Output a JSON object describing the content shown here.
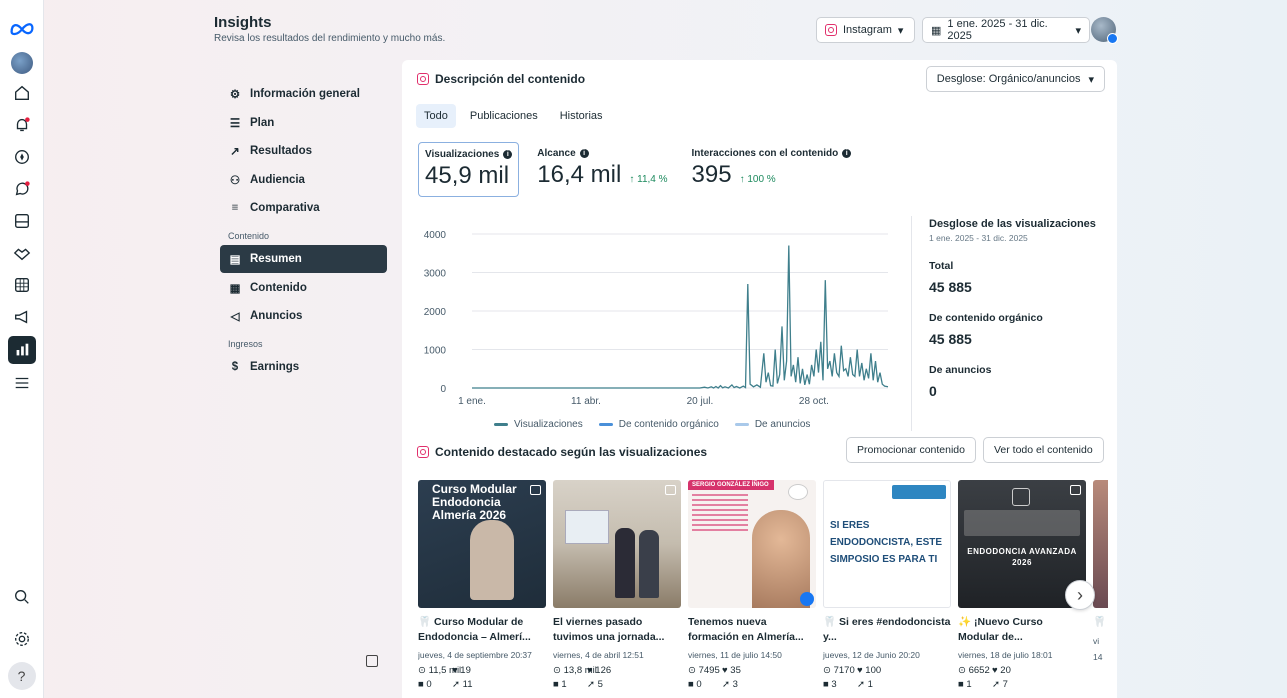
{
  "header": {
    "title": "Insights",
    "subtitle": "Revisa los resultados del rendimiento y mucho más.",
    "platform": "Instagram",
    "date_range": "1 ene. 2025 - 31 dic. 2025"
  },
  "nav": {
    "items": [
      {
        "label": "Información general",
        "icon": "network-icon"
      },
      {
        "label": "Plan",
        "icon": "list-icon"
      },
      {
        "label": "Resultados",
        "icon": "trend-icon"
      },
      {
        "label": "Audiencia",
        "icon": "people-icon"
      },
      {
        "label": "Comparativa",
        "icon": "compare-icon"
      }
    ],
    "section_content": "Contenido",
    "content_items": [
      {
        "label": "Resumen",
        "icon": "summary-icon",
        "active": true
      },
      {
        "label": "Contenido",
        "icon": "grid-icon"
      },
      {
        "label": "Anuncios",
        "icon": "megaphone-icon"
      }
    ],
    "section_income": "Ingresos",
    "income_items": [
      {
        "label": "Earnings",
        "icon": "dollar-icon"
      }
    ]
  },
  "content_overview": {
    "title": "Descripción del contenido",
    "breakdown_button": "Desglose: Orgánico/anuncios",
    "tabs": [
      "Todo",
      "Publicaciones",
      "Historias"
    ],
    "metrics": [
      {
        "label": "Visualizaciones",
        "value": "45,9 mil",
        "delta": ""
      },
      {
        "label": "Alcance",
        "value": "16,4 mil",
        "delta": "↑ 11,4 %"
      },
      {
        "label": "Interacciones con el contenido",
        "value": "395",
        "delta": "↑ 100 %"
      }
    ]
  },
  "chart_data": {
    "type": "line",
    "x_ticks": [
      "1 ene.",
      "11 abr.",
      "20 jul.",
      "28 oct."
    ],
    "y_ticks": [
      "0",
      "1000",
      "2000",
      "3000",
      "4000"
    ],
    "ylim": [
      0,
      4000
    ],
    "xlim_days": [
      0,
      365
    ],
    "series": [
      {
        "name": "Visualizaciones",
        "color": "#3f7f8c",
        "points": [
          [
            0,
            0
          ],
          [
            200,
            0
          ],
          [
            204,
            20
          ],
          [
            207,
            0
          ],
          [
            210,
            30
          ],
          [
            212,
            0
          ],
          [
            214,
            40
          ],
          [
            216,
            0
          ],
          [
            218,
            60
          ],
          [
            220,
            5
          ],
          [
            222,
            30
          ],
          [
            225,
            0
          ],
          [
            228,
            80
          ],
          [
            230,
            10
          ],
          [
            232,
            40
          ],
          [
            235,
            0
          ],
          [
            238,
            50
          ],
          [
            240,
            10
          ],
          [
            242,
            2700
          ],
          [
            244,
            100
          ],
          [
            247,
            30
          ],
          [
            250,
            80
          ],
          [
            253,
            20
          ],
          [
            256,
            900
          ],
          [
            258,
            150
          ],
          [
            260,
            400
          ],
          [
            262,
            60
          ],
          [
            264,
            50
          ],
          [
            266,
            1000
          ],
          [
            268,
            120
          ],
          [
            270,
            350
          ],
          [
            272,
            1600
          ],
          [
            274,
            200
          ],
          [
            276,
            700
          ],
          [
            278,
            3700
          ],
          [
            280,
            300
          ],
          [
            282,
            600
          ],
          [
            284,
            150
          ],
          [
            286,
            800
          ],
          [
            288,
            120
          ],
          [
            290,
            500
          ],
          [
            292,
            80
          ],
          [
            294,
            350
          ],
          [
            296,
            100
          ],
          [
            298,
            600
          ],
          [
            300,
            300
          ],
          [
            302,
            1000
          ],
          [
            304,
            400
          ],
          [
            306,
            1200
          ],
          [
            308,
            200
          ],
          [
            310,
            2800
          ],
          [
            312,
            500
          ],
          [
            314,
            700
          ],
          [
            316,
            300
          ],
          [
            318,
            900
          ],
          [
            320,
            400
          ],
          [
            322,
            300
          ],
          [
            324,
            1100
          ],
          [
            326,
            450
          ],
          [
            328,
            500
          ],
          [
            330,
            300
          ],
          [
            332,
            800
          ],
          [
            334,
            350
          ],
          [
            336,
            300
          ],
          [
            338,
            1000
          ],
          [
            340,
            300
          ],
          [
            342,
            650
          ],
          [
            344,
            200
          ],
          [
            346,
            500
          ],
          [
            348,
            250
          ],
          [
            350,
            900
          ],
          [
            352,
            200
          ],
          [
            354,
            700
          ],
          [
            356,
            150
          ],
          [
            358,
            400
          ],
          [
            360,
            100
          ],
          [
            362,
            50
          ],
          [
            365,
            30
          ]
        ]
      },
      {
        "name": "De contenido orgánico",
        "color": "#4a90d9"
      },
      {
        "name": "De anuncios",
        "color": "#a9c9ea"
      }
    ]
  },
  "breakdown": {
    "title": "Desglose de las visualizaciones",
    "date": "1 ene. 2025 - 31 dic. 2025",
    "total_label": "Total",
    "total_value": "45 885",
    "organic_label": "De contenido orgánico",
    "organic_value": "45 885",
    "ads_label": "De anuncios",
    "ads_value": "0"
  },
  "featured": {
    "title": "Contenido destacado según las visualizaciones",
    "promote_button": "Promocionar contenido",
    "view_all_button": "Ver todo el contenido",
    "posts": [
      {
        "title": "🦷 Curso Modular de Endodoncia – Almerí...",
        "date": "jueves, 4 de septiembre 20:37",
        "views": "11,5 mil",
        "likes": "19",
        "comments": "0",
        "shares": "11",
        "thumb_text": "Curso Modular Endodoncia Almería 2026"
      },
      {
        "title": "El viernes pasado tuvimos una jornada...",
        "date": "viernes, 4 de abril 12:51",
        "views": "13,8 mil",
        "likes": "126",
        "comments": "1",
        "shares": "5",
        "thumb_text": ""
      },
      {
        "title": "Tenemos nueva formación en Almería...",
        "date": "viernes, 11 de julio 14:50",
        "views": "7495",
        "likes": "35",
        "comments": "0",
        "shares": "3",
        "thumb_text": "SERGIO GONZÁLEZ ÍÑIGO"
      },
      {
        "title": "🦷 Si eres #endodoncista y...",
        "date": "jueves, 12 de Junio 20:20",
        "views": "7170",
        "likes": "100",
        "comments": "3",
        "shares": "1",
        "thumb_text": "SI ERES ENDODONCISTA, ESTE SIMPOSIO ES PARA TI"
      },
      {
        "title": "✨ ¡Nuevo Curso Modular de...",
        "date": "viernes, 18 de julio 18:01",
        "views": "6652",
        "likes": "20",
        "comments": "1",
        "shares": "7",
        "thumb_text": "ENDODONCIA AVANZADA 2026"
      },
      {
        "title": "🦷 el",
        "date": "vi",
        "views": "14",
        "likes": "",
        "comments": "",
        "shares": "",
        "thumb_text": ""
      }
    ]
  }
}
